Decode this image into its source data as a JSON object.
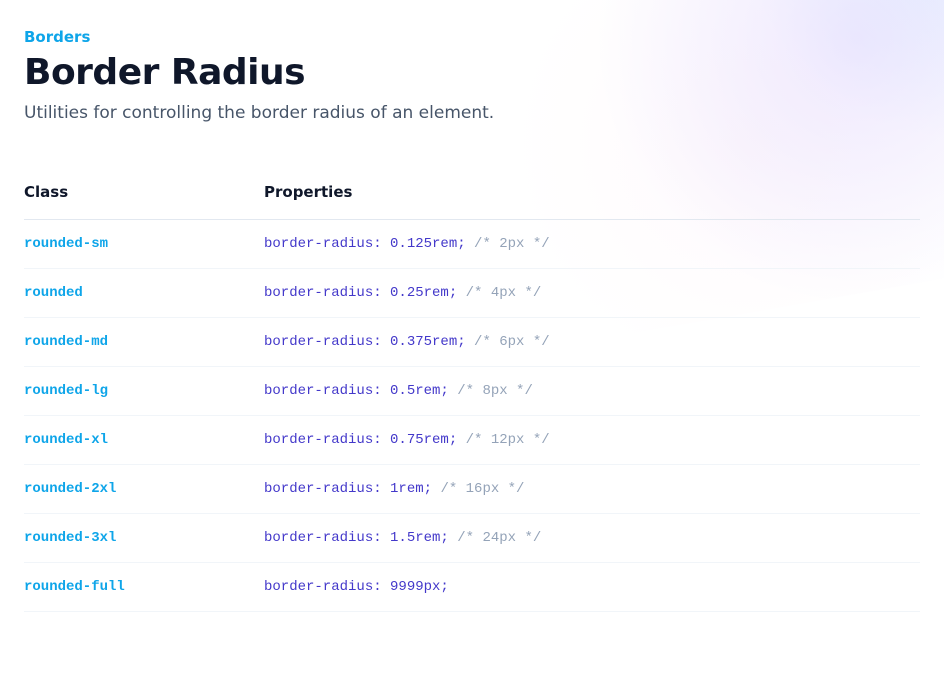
{
  "header": {
    "eyebrow": "Borders",
    "title": "Border Radius",
    "subtitle": "Utilities for controlling the border radius of an element."
  },
  "table": {
    "headers": {
      "class": "Class",
      "properties": "Properties"
    },
    "rows": [
      {
        "class": "rounded-sm",
        "property": "border-radius: 0.125rem;",
        "comment": "/* 2px */"
      },
      {
        "class": "rounded",
        "property": "border-radius: 0.25rem;",
        "comment": "/* 4px */"
      },
      {
        "class": "rounded-md",
        "property": "border-radius: 0.375rem;",
        "comment": "/* 6px */"
      },
      {
        "class": "rounded-lg",
        "property": "border-radius: 0.5rem;",
        "comment": "/* 8px */"
      },
      {
        "class": "rounded-xl",
        "property": "border-radius: 0.75rem;",
        "comment": "/* 12px */"
      },
      {
        "class": "rounded-2xl",
        "property": "border-radius: 1rem;",
        "comment": "/* 16px */"
      },
      {
        "class": "rounded-3xl",
        "property": "border-radius: 1.5rem;",
        "comment": "/* 24px */"
      },
      {
        "class": "rounded-full",
        "property": "border-radius: 9999px;",
        "comment": ""
      }
    ]
  }
}
